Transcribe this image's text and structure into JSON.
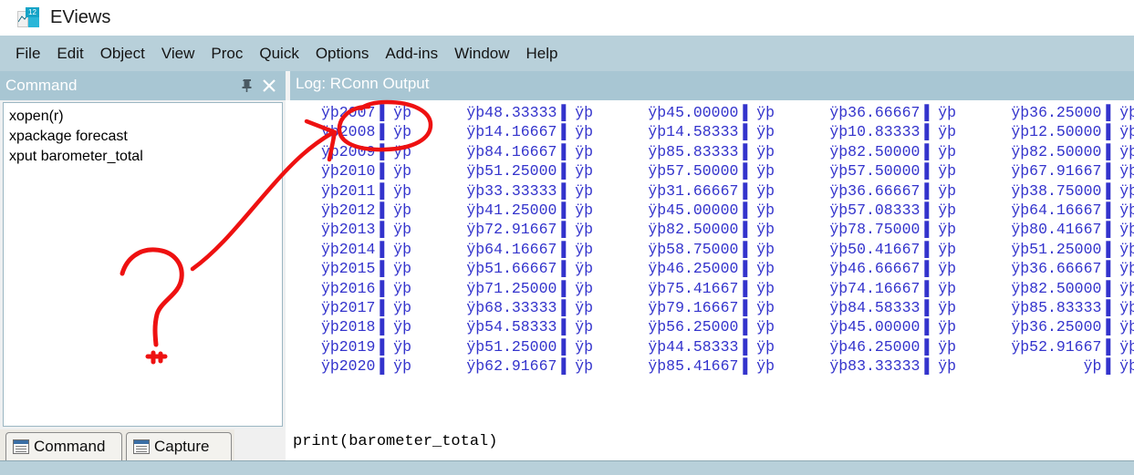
{
  "window": {
    "title": "EViews",
    "icon": "eviews-chart-icon",
    "icon_badge": "12"
  },
  "menubar": {
    "items": [
      {
        "label": "File"
      },
      {
        "label": "Edit"
      },
      {
        "label": "Object"
      },
      {
        "label": "View"
      },
      {
        "label": "Proc"
      },
      {
        "label": "Quick"
      },
      {
        "label": "Options"
      },
      {
        "label": "Add-ins"
      },
      {
        "label": "Window"
      },
      {
        "label": "Help"
      }
    ]
  },
  "command_panel": {
    "title": "Command",
    "pin_icon": "pin-icon",
    "close_icon": "close-icon",
    "lines": [
      "xopen(r)",
      "xpackage forecast",
      "xput barometer_total"
    ]
  },
  "log_panel": {
    "title": "Log: RConn Output",
    "rows": [
      [
        "ÿþ2007▐ ÿþ",
        "ÿþ48.33333▐ ÿþ",
        "ÿþ45.00000▐ ÿþ",
        "ÿþ36.66667▐ ÿþ",
        "ÿþ36.25000▐ ÿþ"
      ],
      [
        "ÿþ2008▐ ÿþ",
        "ÿþ14.16667▐ ÿþ",
        "ÿþ14.58333▐ ÿþ",
        "ÿþ10.83333▐ ÿþ",
        "ÿþ12.50000▐ ÿþ"
      ],
      [
        "ÿþ2009▐ ÿþ",
        "ÿþ84.16667▐ ÿþ",
        "ÿþ85.83333▐ ÿþ",
        "ÿþ82.50000▐ ÿþ",
        "ÿþ82.50000▐ ÿþ"
      ],
      [
        "ÿþ2010▐ ÿþ",
        "ÿþ51.25000▐ ÿþ",
        "ÿþ57.50000▐ ÿþ",
        "ÿþ57.50000▐ ÿþ",
        "ÿþ67.91667▐ ÿþ"
      ],
      [
        "ÿþ2011▐ ÿþ",
        "ÿþ33.33333▐ ÿþ",
        "ÿþ31.66667▐ ÿþ",
        "ÿþ36.66667▐ ÿþ",
        "ÿþ38.75000▐ ÿþ"
      ],
      [
        "ÿþ2012▐ ÿþ",
        "ÿþ41.25000▐ ÿþ",
        "ÿþ45.00000▐ ÿþ",
        "ÿþ57.08333▐ ÿþ",
        "ÿþ64.16667▐ ÿþ"
      ],
      [
        "ÿþ2013▐ ÿþ",
        "ÿþ72.91667▐ ÿþ",
        "ÿþ82.50000▐ ÿþ",
        "ÿþ78.75000▐ ÿþ",
        "ÿþ80.41667▐ ÿþ"
      ],
      [
        "ÿþ2014▐ ÿþ",
        "ÿþ64.16667▐ ÿþ",
        "ÿþ58.75000▐ ÿþ",
        "ÿþ50.41667▐ ÿþ",
        "ÿþ51.25000▐ ÿþ"
      ],
      [
        "ÿþ2015▐ ÿþ",
        "ÿþ51.66667▐ ÿþ",
        "ÿþ46.25000▐ ÿþ",
        "ÿþ46.66667▐ ÿþ",
        "ÿþ36.66667▐ ÿþ"
      ],
      [
        "ÿþ2016▐ ÿþ",
        "ÿþ71.25000▐ ÿþ",
        "ÿþ75.41667▐ ÿþ",
        "ÿþ74.16667▐ ÿþ",
        "ÿþ82.50000▐ ÿþ"
      ],
      [
        "ÿþ2017▐ ÿþ",
        "ÿþ68.33333▐ ÿþ",
        "ÿþ79.16667▐ ÿþ",
        "ÿþ84.58333▐ ÿþ",
        "ÿþ85.83333▐ ÿþ"
      ],
      [
        "ÿþ2018▐ ÿþ",
        "ÿþ54.58333▐ ÿþ",
        "ÿþ56.25000▐ ÿþ",
        "ÿþ45.00000▐ ÿþ",
        "ÿþ36.25000▐ ÿþ"
      ],
      [
        "ÿþ2019▐ ÿþ",
        "ÿþ51.25000▐ ÿþ",
        "ÿþ44.58333▐ ÿþ",
        "ÿþ46.25000▐ ÿþ",
        "ÿþ52.91667▐ ÿþ"
      ],
      [
        "ÿþ2020▐ ÿþ",
        "ÿþ62.91667▐ ÿþ",
        "ÿþ85.41667▐ ÿþ",
        "ÿþ83.33333▐ ÿþ",
        "ÿþ▐ ÿþ"
      ]
    ]
  },
  "tabs": [
    {
      "label": "Command",
      "icon": "window-doc-icon",
      "active": false
    },
    {
      "label": "Capture",
      "icon": "window-doc-icon",
      "active": true
    }
  ],
  "command_entry": {
    "value": "print(barometer_total)"
  },
  "annotation": {
    "color": "#ee1111",
    "marks": [
      "question-mark",
      "curved-arrow",
      "ellipse-circle"
    ]
  },
  "colors": {
    "menubar": "#b8d0da",
    "panel_header": "#a8c6d3",
    "log_text": "#3333cc",
    "annotation_red": "#ee1111",
    "statusbar": "#b8d0da"
  }
}
